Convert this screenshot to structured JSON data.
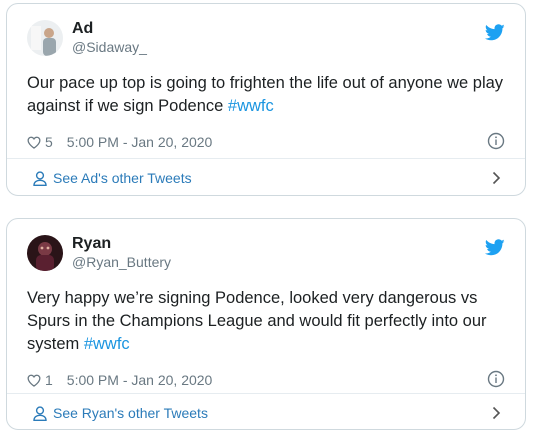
{
  "colors": {
    "accent": "#1b95e0",
    "link": "#2b7bb9",
    "muted": "#697882",
    "border": "#cfd9de"
  },
  "tweets": [
    {
      "display_name": "Ad",
      "handle": "@Sidaway_",
      "text_before": "Our pace up top is going to frighten the life out of anyone we play against if we sign Podence ",
      "hashtag": "#wwfc",
      "text_after": "",
      "likes": "5",
      "timestamp": "5:00 PM - Jan 20, 2020",
      "footer_label": "See Ad's other Tweets",
      "icons": [
        "heart-icon",
        "info-icon",
        "twitter-bird-icon",
        "person-icon",
        "chevron-right-icon"
      ]
    },
    {
      "display_name": "Ryan",
      "handle": "@Ryan_Buttery",
      "text_before": "Very happy we’re signing Podence, looked very dangerous vs Spurs in the Champions League and would fit perfectly into our system ",
      "hashtag": "#wwfc",
      "text_after": "",
      "likes": "1",
      "timestamp": "5:00 PM - Jan 20, 2020",
      "footer_label": "See Ryan's other Tweets",
      "icons": [
        "heart-icon",
        "info-icon",
        "twitter-bird-icon",
        "person-icon",
        "chevron-right-icon"
      ]
    }
  ]
}
